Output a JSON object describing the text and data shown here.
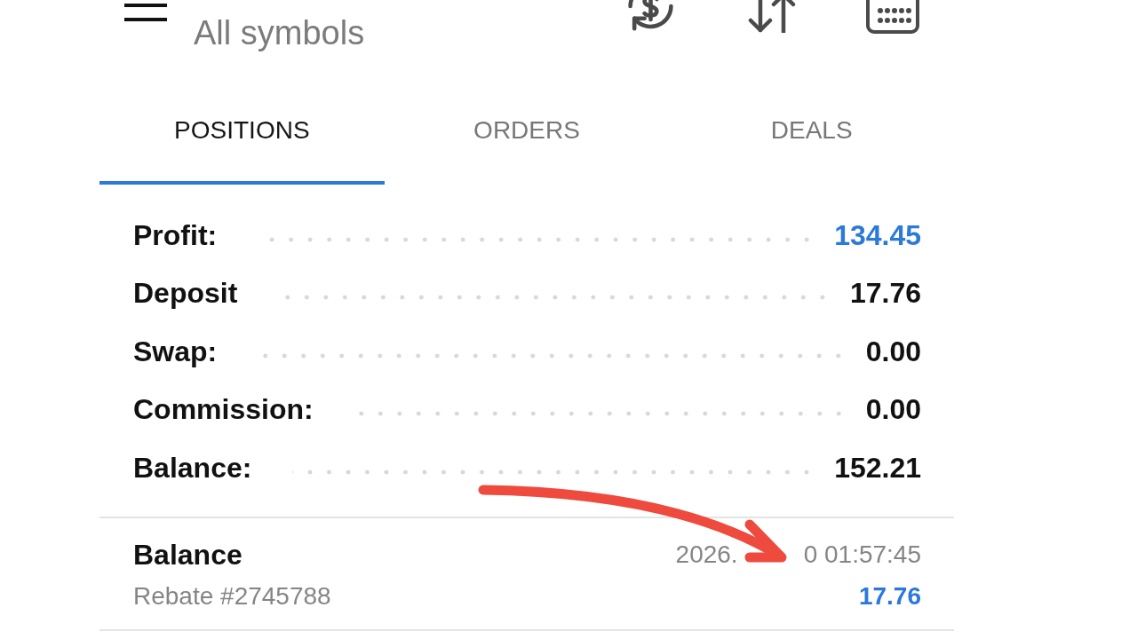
{
  "header": {
    "subtitle": "All symbols"
  },
  "tabs": [
    {
      "label": "POSITIONS",
      "selected": true
    },
    {
      "label": "ORDERS",
      "selected": false
    },
    {
      "label": "DEALS",
      "selected": false
    }
  ],
  "summary": [
    {
      "label": "Profit:",
      "value": "134.45",
      "color": "#2b79d8"
    },
    {
      "label": "Deposit",
      "value": "17.76",
      "color": "#111111"
    },
    {
      "label": "Swap:",
      "value": "0.00",
      "color": "#111111"
    },
    {
      "label": "Commission:",
      "value": "0.00",
      "color": "#111111"
    },
    {
      "label": "Balance:",
      "value": "152.21",
      "color": "#111111"
    }
  ],
  "deals": [
    {
      "title": "Balance",
      "comment": "Rebate #2745788",
      "time_parts": [
        "2026.",
        "0 01:57:45"
      ],
      "amount": "17.76"
    }
  ],
  "annotation": {
    "kind": "arrow"
  }
}
